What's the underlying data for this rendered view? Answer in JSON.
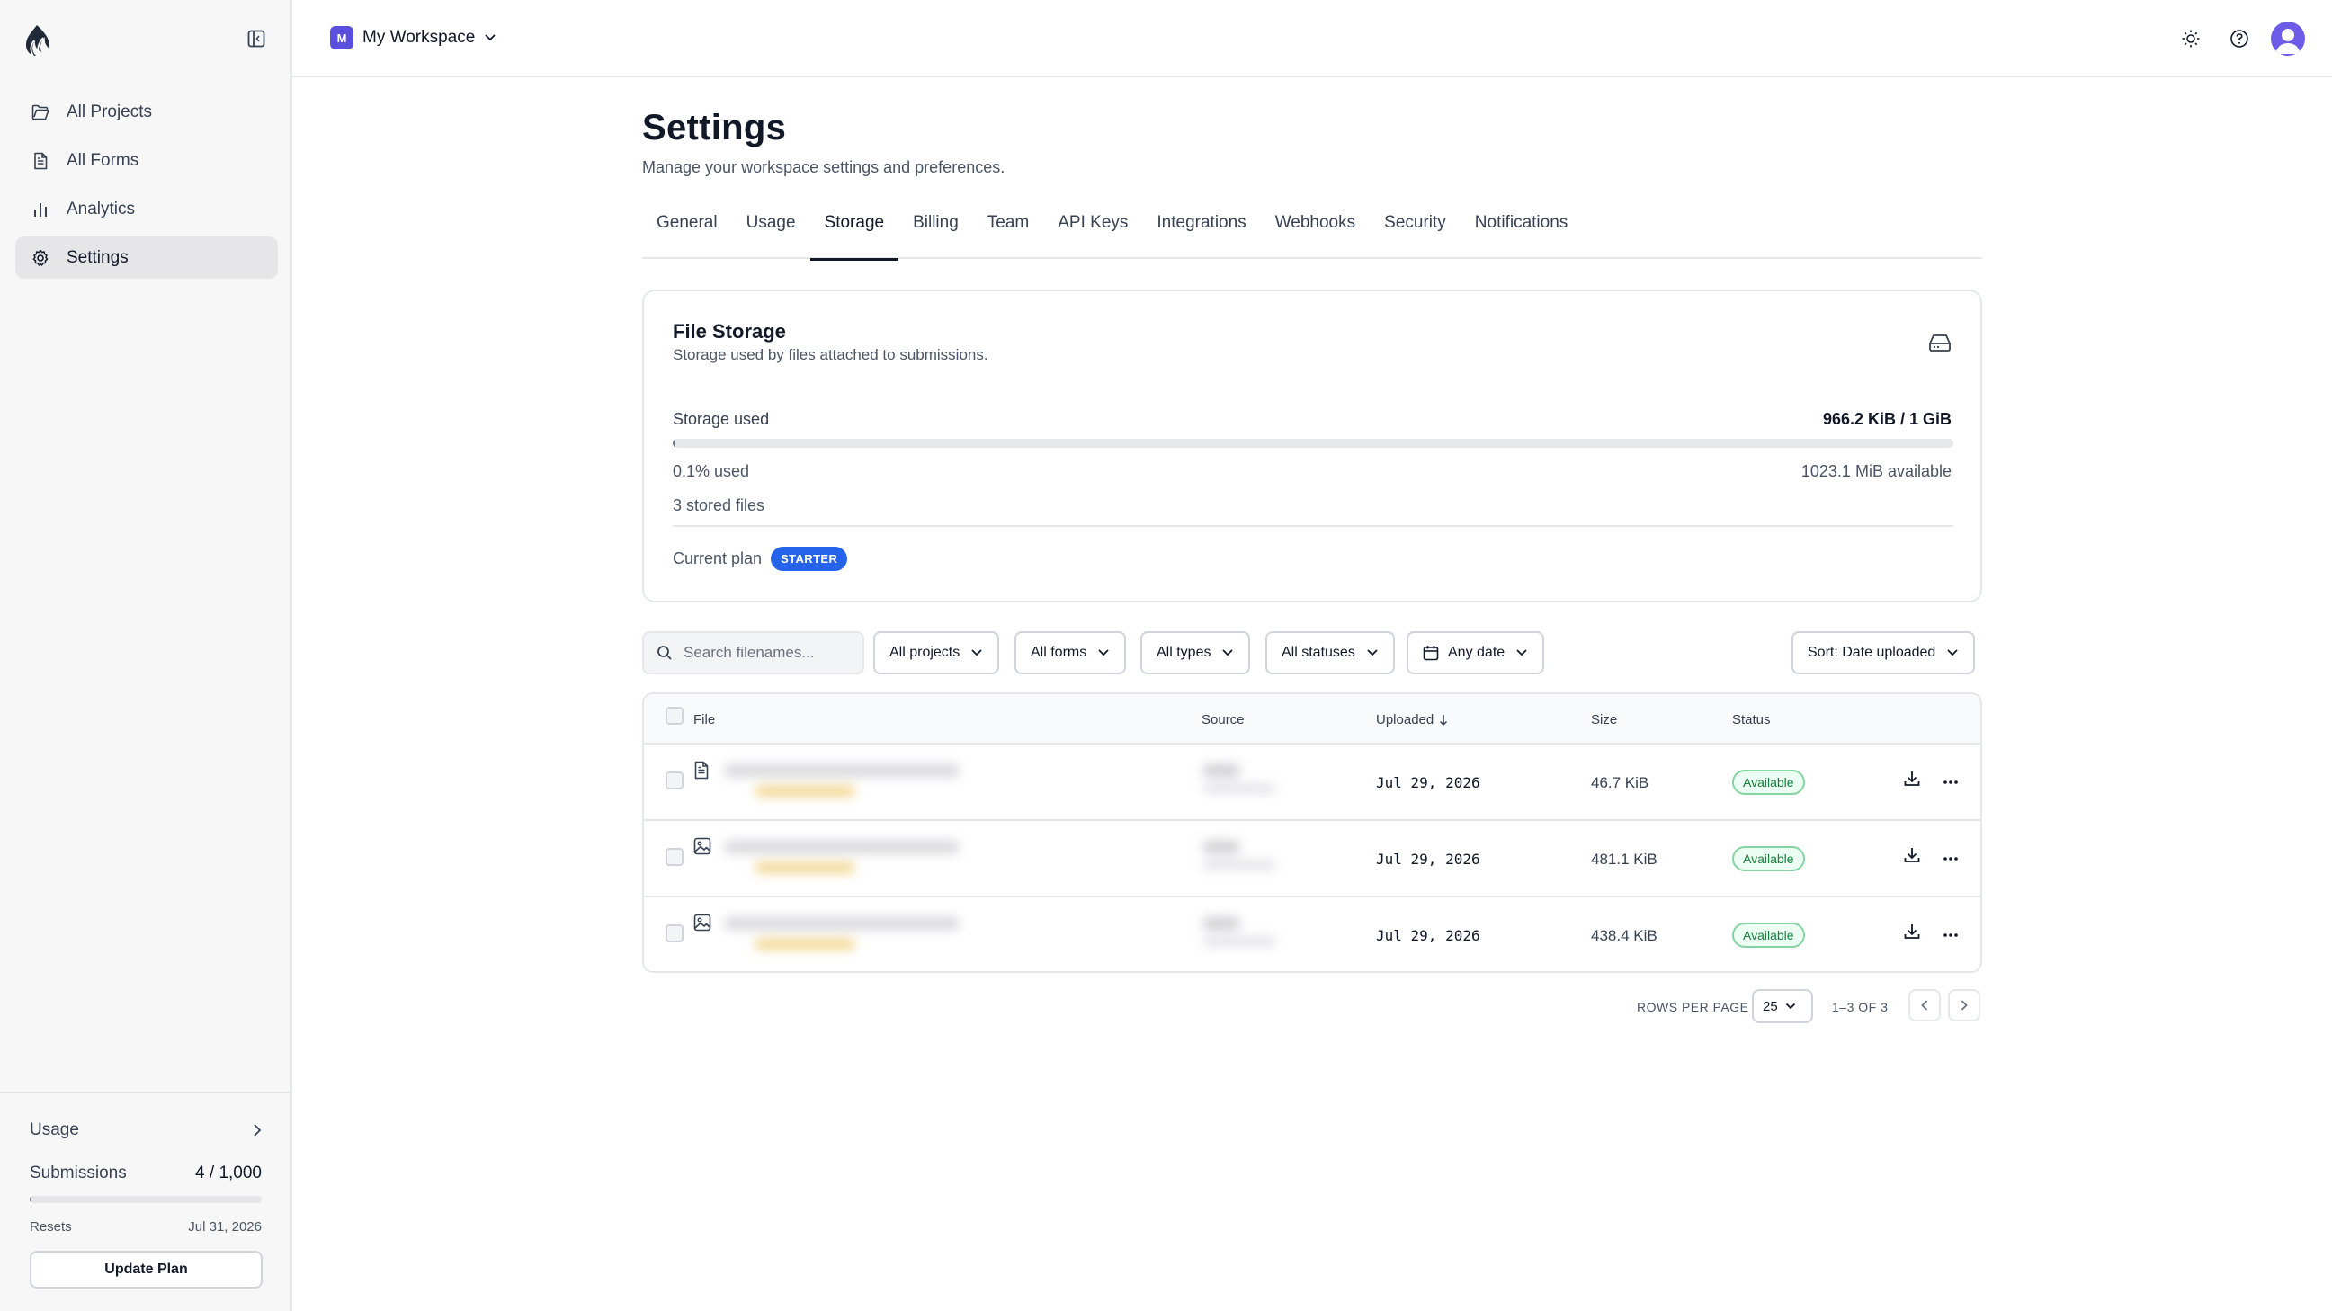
{
  "sidebar": {
    "items": [
      {
        "label": "All Projects"
      },
      {
        "label": "All Forms"
      },
      {
        "label": "Analytics"
      },
      {
        "label": "Settings"
      }
    ],
    "usage": {
      "title": "Usage",
      "submissions_label": "Submissions",
      "submissions_value": "4 / 1,000",
      "submissions_fraction": 0.004,
      "resets_label": "Resets",
      "resets_date": "Jul 31, 2026",
      "update_button": "Update Plan"
    }
  },
  "topbar": {
    "workspace_initial": "M",
    "workspace_name": "My Workspace",
    "accent_color": "#5b4fe0"
  },
  "page": {
    "title": "Settings",
    "subtitle": "Manage your workspace settings and preferences.",
    "tabs": [
      {
        "label": "General"
      },
      {
        "label": "Usage"
      },
      {
        "label": "Storage",
        "active": true
      },
      {
        "label": "Billing"
      },
      {
        "label": "Team"
      },
      {
        "label": "API Keys"
      },
      {
        "label": "Integrations"
      },
      {
        "label": "Webhooks"
      },
      {
        "label": "Security"
      },
      {
        "label": "Notifications"
      }
    ]
  },
  "storage": {
    "title": "File Storage",
    "subtitle": "Storage used by files attached to submissions.",
    "used_label": "Storage used",
    "used_value": "966.2 KiB / 1 GiB",
    "used_fraction": 0.001,
    "percent_text": "0.1% used",
    "available_text": "1023.1 MiB available",
    "stored_files": "3 stored files",
    "plan_label": "Current plan",
    "plan_badge": "STARTER",
    "plan_color": "#2563eb"
  },
  "filters": {
    "search_placeholder": "Search filenames...",
    "projects": "All projects",
    "forms": "All forms",
    "types": "All types",
    "statuses": "All statuses",
    "date": "Any date",
    "sort": "Sort: Date uploaded"
  },
  "table": {
    "headers": {
      "file": "File",
      "source": "Source",
      "uploaded": "Uploaded",
      "size": "Size",
      "status": "Status"
    },
    "rows": [
      {
        "icon": "document-icon",
        "uploaded": "Jul 29, 2026",
        "size": "46.7 KiB",
        "status": "Available"
      },
      {
        "icon": "image-icon",
        "uploaded": "Jul 29, 2026",
        "size": "481.1 KiB",
        "status": "Available"
      },
      {
        "icon": "image-icon",
        "uploaded": "Jul 29, 2026",
        "size": "438.4 KiB",
        "status": "Available"
      }
    ]
  },
  "pagination": {
    "rows_per_page_label": "ROWS PER PAGE",
    "rows_per_page": "25",
    "range": "1–3 OF 3"
  }
}
